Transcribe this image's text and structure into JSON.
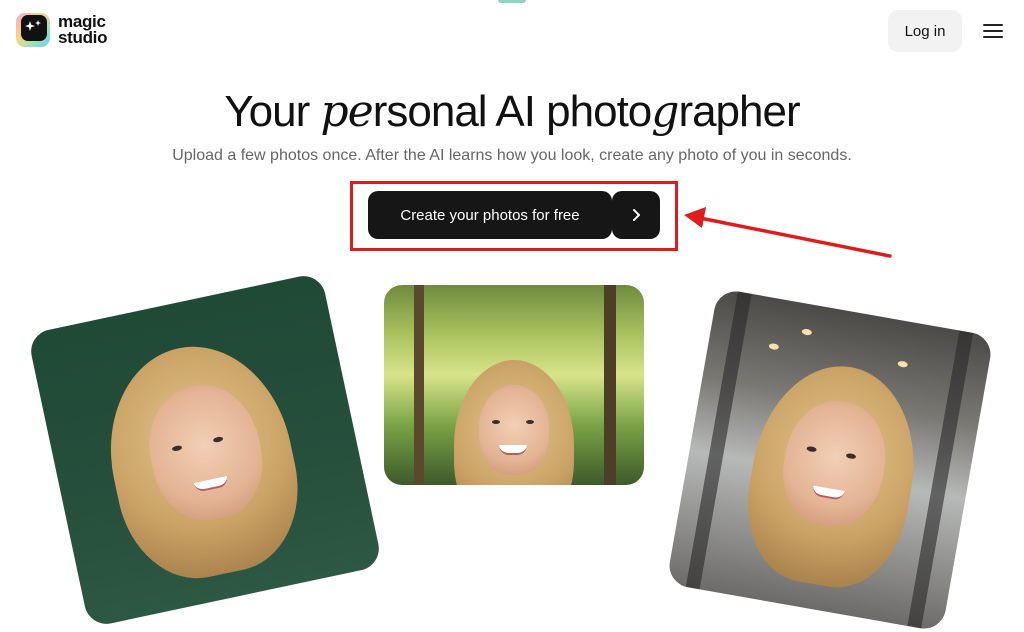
{
  "header": {
    "logo_line1": "magic",
    "logo_line2": "studio",
    "login_label": "Log in"
  },
  "hero": {
    "title_before": "Your ",
    "title_accent": "pe",
    "title_after": "rsonal AI photo",
    "title_accent2": "g",
    "title_end": "rapher",
    "subtitle": "Upload a few photos once. After the AI learns how you look, create any photo of you in seconds.",
    "cta_label": "Create your photos for free"
  },
  "icons": {
    "logo": "sparkle-logo-icon",
    "menu": "hamburger-menu-icon",
    "cta_arrow": "chevron-right-icon"
  },
  "colors": {
    "brand_dark": "#161616",
    "annotation_red": "#e01b1b",
    "login_bg": "#f2f2f2"
  }
}
